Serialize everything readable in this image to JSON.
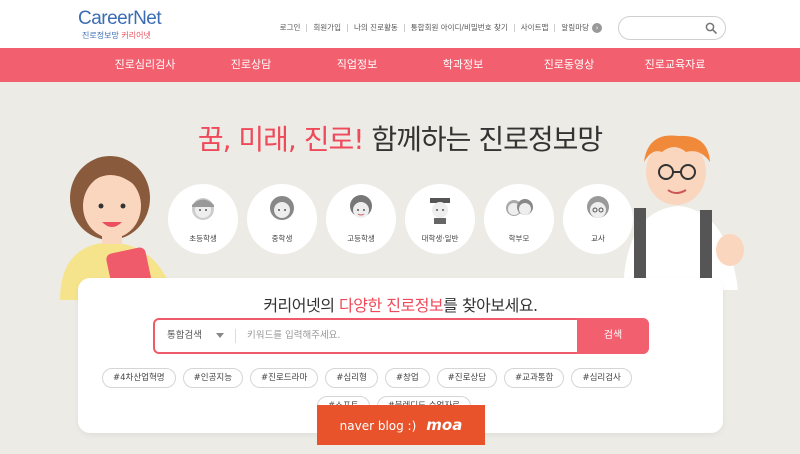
{
  "header": {
    "logo": {
      "brand": "CareerNet",
      "sub_main": "진로정보망",
      "sub_pink": "커리어넷"
    },
    "utility_links": [
      "로그인",
      "회원가입",
      "나의 진로활동",
      "통합회원 아이디/비밀번호 찾기",
      "사이트맵",
      "알림마당"
    ],
    "search_placeholder": ""
  },
  "nav": {
    "items": [
      "진로심리검사",
      "진로상담",
      "직업정보",
      "학과정보",
      "진로동영상",
      "진로교육자료"
    ]
  },
  "hero": {
    "headline_pink": "꿈, 미래, 진로!",
    "headline_rest": " 함께하는 진로정보망",
    "personas": [
      "초등학생",
      "중학생",
      "고등학생",
      "대학생·일반",
      "학부모",
      "교사"
    ]
  },
  "search_card": {
    "title_pre": "커리어넷의 ",
    "title_pink": "다양한 진로정보",
    "title_post": "를 찾아보세요.",
    "scope": "통합검색",
    "placeholder": "키워드를 입력해주세요.",
    "button": "검색",
    "tags": [
      "#4차산업혁명",
      "#인공지능",
      "#진로드라마",
      "#심리형",
      "#창업",
      "#진로상담",
      "#교과통합",
      "#심리검사",
      "#소프트",
      "#블렌디드 수업자료"
    ]
  },
  "watermark": {
    "text": "naver blog :)",
    "name": "moa"
  },
  "colors": {
    "accent": "#f25f6f",
    "brand_blue": "#3b6db3",
    "background": "#ecebe5"
  }
}
